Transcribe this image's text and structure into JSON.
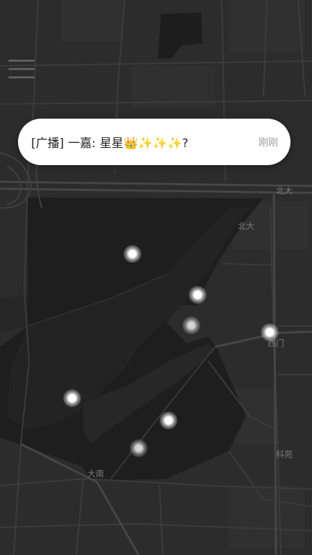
{
  "menu": {
    "icon": "hamburger-menu-icon"
  },
  "broadcast": {
    "tag": "[广播]",
    "sender": "一嘉:",
    "text": "星星👑✨✨✨?",
    "time": "刚刚"
  },
  "map_labels": {
    "beida_east": "北大",
    "beida_inner": "北大",
    "gate": "西门",
    "south_road": "大南",
    "keyuan": "科苑"
  },
  "markers": {
    "count": 7
  },
  "colors": {
    "background": "#2b2b2b",
    "campus_dark": "#1f1f1f",
    "road": "#3a3a3a",
    "toast_bg": "#ffffff"
  }
}
